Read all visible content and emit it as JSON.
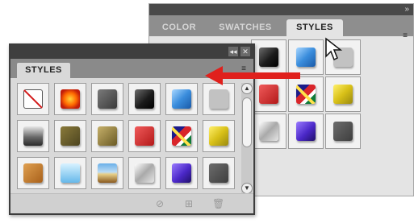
{
  "background_panel": {
    "tabs": [
      {
        "label": "COLOR",
        "active": false
      },
      {
        "label": "SWATCHES",
        "active": false
      },
      {
        "label": "STYLES",
        "active": true
      }
    ],
    "menu_icon": "double-arrow-icon",
    "swatch_rows": [
      [
        "black",
        "blue",
        "ltgray"
      ],
      [
        "red",
        "mosaic",
        "yellow"
      ],
      [
        "silver",
        "purple",
        "charcoal"
      ]
    ]
  },
  "floating_panel": {
    "title_buttons": [
      {
        "icon": "collapse-icon",
        "glyph": "◂◂"
      },
      {
        "icon": "close-icon",
        "glyph": "✕"
      }
    ],
    "tab_label": "STYLES",
    "menu_icon": "panel-menu-icon",
    "swatch_rows": [
      [
        "none",
        "glow",
        "dkgray",
        "black",
        "blue",
        "ltgray"
      ],
      [
        "steel",
        "olive",
        "bronze",
        "red",
        "mosaic",
        "yellow"
      ],
      [
        "copper",
        "sky",
        "landscape",
        "silver",
        "purple",
        "charcoal"
      ]
    ],
    "bottom_buttons": [
      {
        "icon": "break-link-icon",
        "glyph": "⊘"
      },
      {
        "icon": "new-style-icon",
        "glyph": "⊞"
      },
      {
        "icon": "delete-icon",
        "glyph": "🗑"
      }
    ]
  },
  "annotation": {
    "arrow_color": "#e0201c",
    "cursor_icon": "move-cursor-icon"
  }
}
